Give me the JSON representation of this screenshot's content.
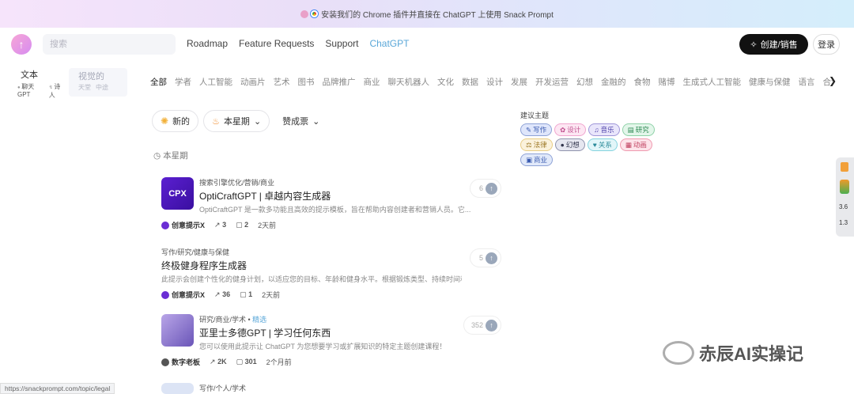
{
  "banner": {
    "text": "安装我们的 Chrome 插件并直接在 ChatGPT 上使用 Snack Prompt"
  },
  "header": {
    "search_placeholder": "搜索",
    "nav": [
      "Roadmap",
      "Feature Requests",
      "Support",
      "ChatGPT"
    ],
    "create_label": "创建/销售",
    "login_label": "登录"
  },
  "type_selector": {
    "text": {
      "title": "文本",
      "subs": [
        "聊天GPT",
        "诗人"
      ]
    },
    "visual": {
      "title": "视觉的",
      "subs": [
        "天堂",
        "中途"
      ]
    }
  },
  "categories": [
    "全部",
    "学者",
    "人工智能",
    "动画片",
    "艺术",
    "图书",
    "品牌推广",
    "商业",
    "聊天机器人",
    "文化",
    "数据",
    "设计",
    "发展",
    "开发运营",
    "幻想",
    "金融的",
    "食物",
    "赌博",
    "生成式人工智能",
    "健康与保健",
    "语言",
    "合法的"
  ],
  "filters": {
    "new": "新的",
    "this_week": "本星期",
    "sort": "赞成票"
  },
  "week_label": "本星期",
  "cards": [
    {
      "meta": "搜索引擎优化/营销/商业",
      "featured": "",
      "title": "OptiCraftGPT | 卓越内容生成器",
      "desc": "OptiCraftGPT 是一款多功能且高效的提示模板，旨在帮助内容创建者和营销人员。它...",
      "author": "创意提示X",
      "uses": "3",
      "comments": "2",
      "time": "2天前",
      "votes": "6",
      "thumb_text": "CPX"
    },
    {
      "meta": "写作/研究/健康与保健",
      "featured": "",
      "title": "终极健身程序生成器",
      "desc": "此提示会创建个性化的健身计划，以适应您的目标、年龄和健身水平。根据锻炼类型、持续时间和...",
      "author": "创意提示X",
      "uses": "36",
      "comments": "1",
      "time": "2天前",
      "votes": "5",
      "thumb_text": ""
    },
    {
      "meta": "研究/商业/学术",
      "featured": "精选",
      "title": "亚里士多德GPT | 学习任何东西",
      "desc": "您可以使用此提示让 ChatGPT 为您想要学习或扩展知识的特定主题创建课程！",
      "author": "数字老板",
      "uses": "2K",
      "comments": "301",
      "time": "2个月前",
      "votes": "352",
      "thumb_text": ""
    },
    {
      "meta": "写作/个人/学术",
      "featured": "",
      "title": "",
      "desc": "",
      "author": "",
      "uses": "",
      "comments": "",
      "time": "",
      "votes": "",
      "thumb_text": ""
    }
  ],
  "sidebar": {
    "label": "建议主题",
    "tags": [
      {
        "label": "写作",
        "icon": "✎",
        "bg": "#dfe6fb",
        "border": "#8ea2d6",
        "color": "#3a5bb0"
      },
      {
        "label": "设计",
        "icon": "✿",
        "bg": "#fde7f3",
        "border": "#f1a6cf",
        "color": "#c0508f"
      },
      {
        "label": "音乐",
        "icon": "♫",
        "bg": "#e9e6fb",
        "border": "#9f96d8",
        "color": "#4c3fa8"
      },
      {
        "label": "研究",
        "icon": "▤",
        "bg": "#e3f6ea",
        "border": "#8fd2a8",
        "color": "#2f8a54"
      },
      {
        "label": "法律",
        "icon": "⚖",
        "bg": "#fbf2dc",
        "border": "#e8cd86",
        "color": "#9a7420"
      },
      {
        "label": "幻想",
        "icon": "●",
        "bg": "#e6e7f0",
        "border": "#8f93ad",
        "color": "#33364d"
      },
      {
        "label": "关系",
        "icon": "♥",
        "bg": "#e2f6f9",
        "border": "#84d3df",
        "color": "#2a8a99"
      },
      {
        "label": "动画",
        "icon": "▦",
        "bg": "#fde4ea",
        "border": "#ef9ab0",
        "color": "#c0405f"
      },
      {
        "label": "商业",
        "icon": "▣",
        "bg": "#e1e9fa",
        "border": "#8ea2d6",
        "color": "#3a5bb0"
      }
    ]
  },
  "widget": {
    "a": "3.6",
    "b": "1.3"
  },
  "status_url": "https://snackprompt.com/topic/legal",
  "watermark": "赤辰AI实操记"
}
